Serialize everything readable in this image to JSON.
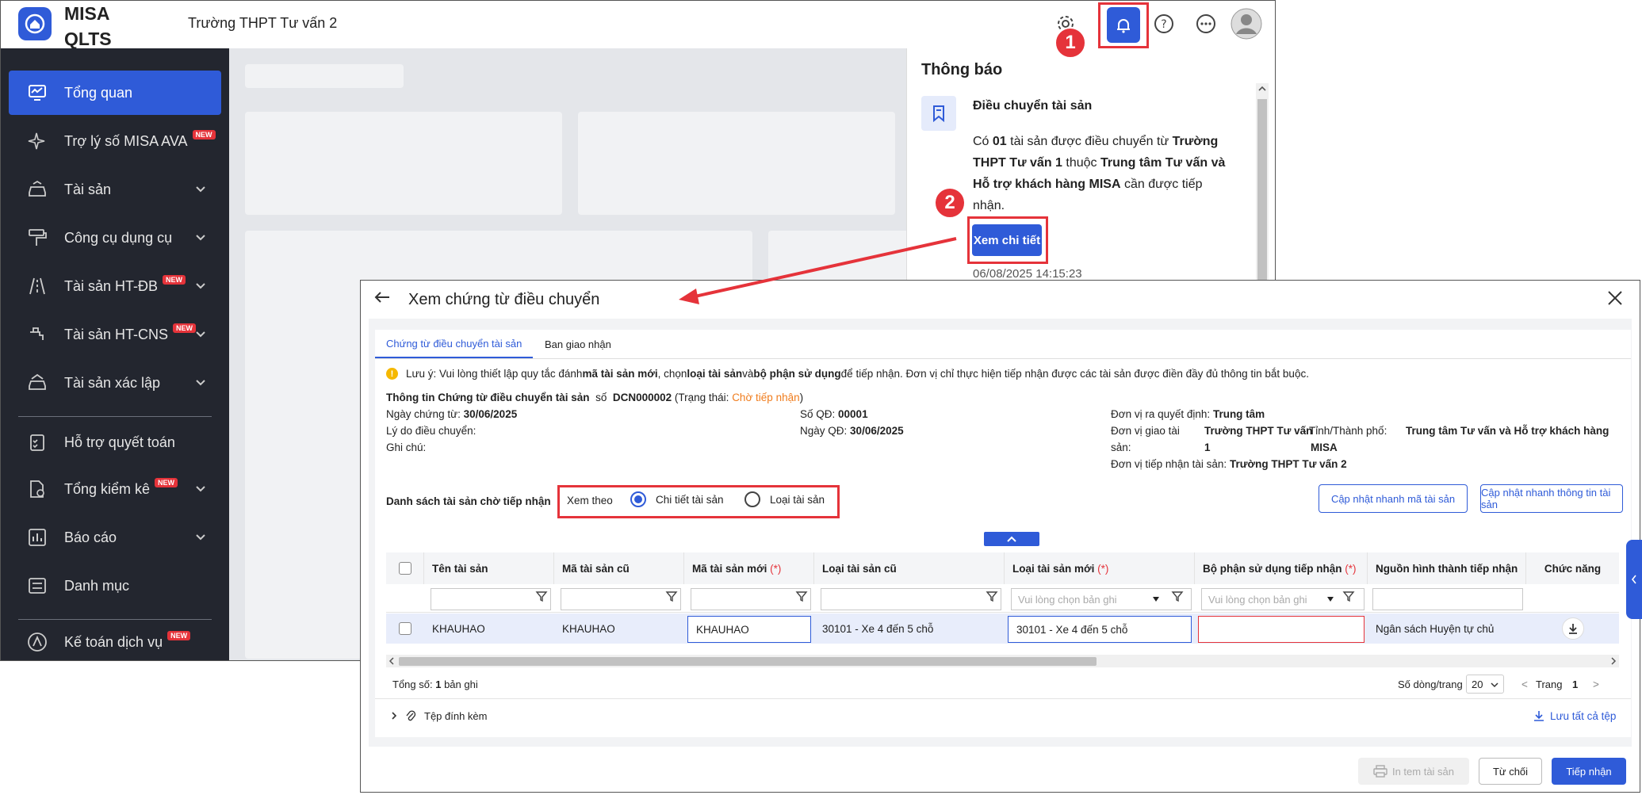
{
  "app": {
    "brand": "MISA QLTS",
    "unit_name": "Trường THPT Tư vấn 2"
  },
  "sidebar": {
    "items": [
      {
        "label": "Tổng quan"
      },
      {
        "label": "Trợ lý số MISA AVA",
        "badge": "NEW"
      },
      {
        "label": "Tài sản"
      },
      {
        "label": "Công cụ dụng cụ"
      },
      {
        "label": "Tài sản HT-ĐB",
        "badge": "NEW"
      },
      {
        "label": "Tài sản HT-CNS",
        "badge": "NEW"
      },
      {
        "label": "Tài sản xác lập"
      },
      {
        "label": "Hỗ trợ quyết toán"
      },
      {
        "label": "Tổng kiểm kê",
        "badge": "NEW"
      },
      {
        "label": "Báo cáo"
      },
      {
        "label": "Danh mục"
      },
      {
        "label": "Kế toán dịch vụ",
        "badge": "NEW"
      }
    ]
  },
  "notification": {
    "title": "Thông báo",
    "item_title": "Điều chuyển tài sản",
    "body_1": "Có ",
    "count": "01",
    "body_2": " tài sản được điều chuyển từ ",
    "from_unit": "Trường THPT Tư vấn 1",
    "body_3": " thuộc ",
    "parent_unit": "Trung tâm Tư vấn và Hỗ trợ khách hàng MISA",
    "body_4": " cần được tiếp nhận.",
    "detail_button": "Xem chi tiết",
    "time": "06/08/2025 14:15:23"
  },
  "steps": {
    "one": "1",
    "two": "2"
  },
  "dialog": {
    "title": "Xem chứng từ điều chuyển",
    "tabs": [
      "Chứng từ điều chuyển tài sản",
      "Ban giao nhận"
    ],
    "note_prefix": "Lưu ý: Vui lòng thiết lập quy tắc đánh ",
    "note_b1": "mã tài sản mới",
    "note_mid1": ", chọn ",
    "note_b2": "loại tài sản",
    "note_mid2": " và ",
    "note_b3": "bộ phận sử dụng",
    "note_suffix": " để tiếp nhận. Đơn vị chỉ thực hiện tiếp nhận được các tài sản được điền đầy đủ thông tin bắt buộc.",
    "info": {
      "heading": "Thông tin Chứng từ điều chuyển tài sản",
      "number_label": "số",
      "number": "DCN000002",
      "status_prefix": "(Trạng thái: ",
      "status": "Chờ tiếp nhận",
      "status_suffix": ")",
      "doc_date_label": "Ngày chứng từ:",
      "doc_date": "30/06/2025",
      "reason_label": "Lý do điều chuyển:",
      "notes_label": "Ghi chú:",
      "decision_no_label": "Số QĐ:",
      "decision_no": "00001",
      "decision_date_label": "Ngày QĐ:",
      "decision_date": "30/06/2025",
      "decider_label": "Đơn vị ra quyết định:",
      "decider": "Trung tâm",
      "sender_label_1": "Đơn vị giao tài",
      "sender_label_2": "sản:",
      "sender_1": "Trường THPT Tư vấn",
      "sender_2": "1",
      "province_label": "- Tỉnh/Thành phố:",
      "province_1": "Trung tâm Tư vấn và Hỗ trợ khách hàng",
      "province_2": "MISA",
      "receiver_label": "Đơn vị tiếp nhận tài sản:",
      "receiver": "Trường THPT Tư vấn 2"
    },
    "list_title": "Danh sách tài sản chờ tiếp nhận",
    "view_by": "Xem theo",
    "view_options": [
      "Chi tiết tài sản",
      "Loại tài sản"
    ],
    "btn_update_code": "Cập nhật nhanh mã tài sản",
    "btn_update_info": "Cập nhật nhanh thông tin tài sản",
    "columns": {
      "name": "Tên tài sản",
      "old_code": "Mã tài sản cũ",
      "new_code": "Mã tài sản mới",
      "old_type": "Loại tài sản cũ",
      "new_type": "Loại tài sản mới",
      "dept": "Bộ phận sử dụng tiếp nhận",
      "source": "Nguồn hình thành tiếp nhận",
      "actions": "Chức năng",
      "required_mark": "(*)"
    },
    "filter_placeholder": "Vui lòng chọn bản ghi",
    "row": {
      "name": "KHAUHAO",
      "old_code": "KHAUHAO",
      "new_code": "KHAUHAO",
      "old_type": "30101 - Xe 4 đến 5 chỗ",
      "new_type": "30101 - Xe 4 đến 5 chỗ",
      "dept": "",
      "source": "Ngân sách Huyện tự chủ"
    },
    "total_label": "Tổng số:",
    "total": "1",
    "total_unit": "bản ghi",
    "page_size_label": "Số dòng/trang",
    "page_size": "20",
    "page_label": "Trang",
    "page": "1",
    "attach_label": "Tệp đính kèm",
    "save_all": "Lưu tất cả tệp",
    "btn_print": "In tem tài sản",
    "btn_reject": "Từ chối",
    "btn_accept": "Tiếp nhận"
  },
  "colors": {
    "accent": "#2f5bd8",
    "highlight": "#e5333a",
    "status": "#f07c1c"
  }
}
